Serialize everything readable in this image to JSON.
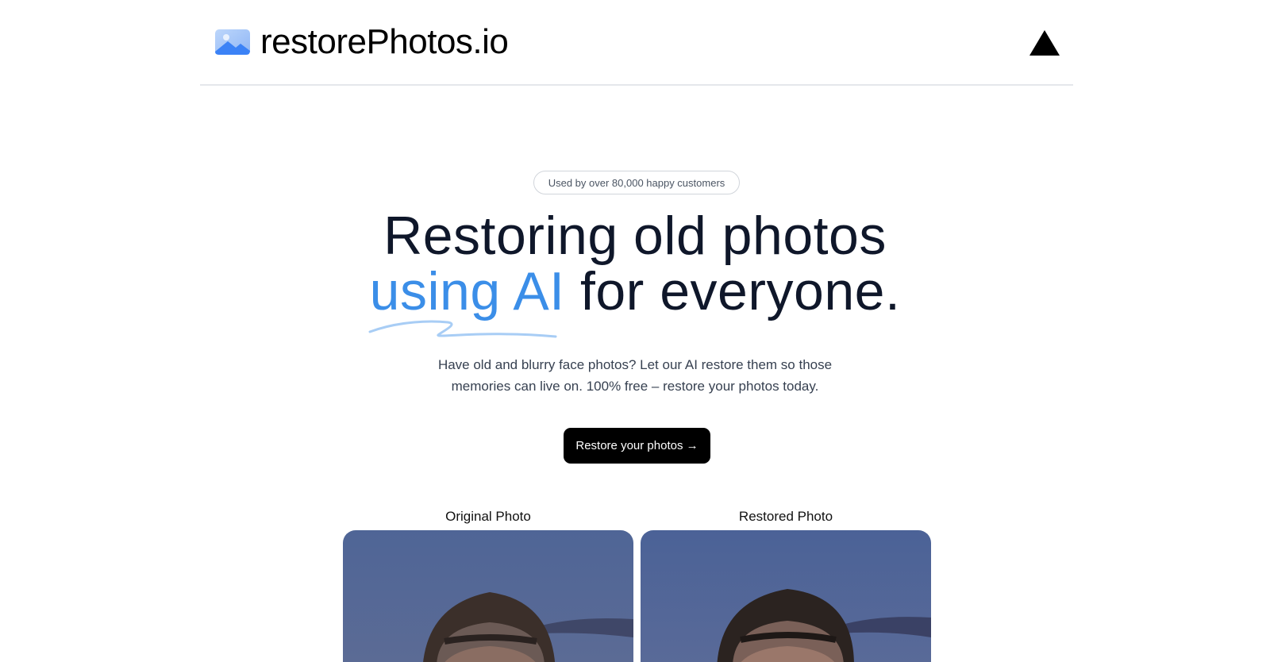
{
  "header": {
    "brand": "restorePhotos.io",
    "logo_icon": "mountain-image-icon",
    "vercel_icon": "triangle-logo-icon"
  },
  "hero": {
    "badge": "Used by over 80,000 happy customers",
    "headline_line1": "Restoring old photos",
    "headline_accent": "using AI",
    "headline_rest": " for everyone.",
    "subtitle": "Have old and blurry face photos? Let our AI restore them so those memories can live on. 100% free – restore your photos today.",
    "cta_label": "Restore your photos →"
  },
  "comparison": {
    "original_label": "Original Photo",
    "restored_label": "Restored Photo"
  },
  "colors": {
    "accent": "#3b8ee8",
    "cta_bg": "#000000",
    "divider": "#e5e7eb"
  }
}
